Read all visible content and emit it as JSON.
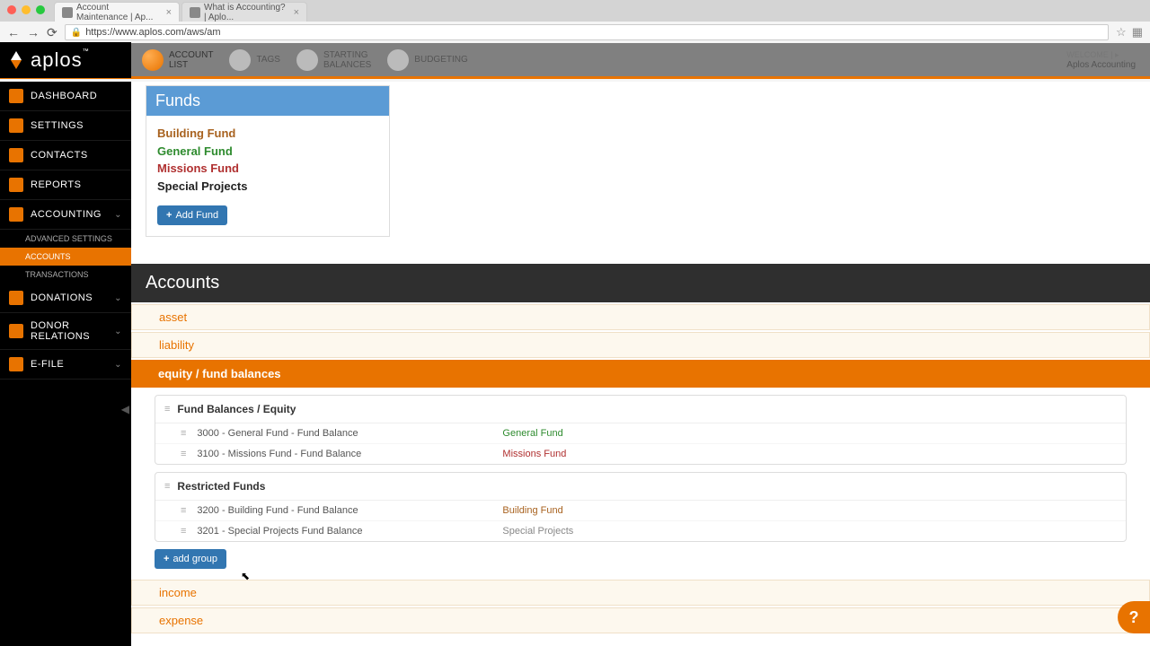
{
  "browser": {
    "tabs": [
      {
        "title": "Account Maintenance | Ap...",
        "active": true
      },
      {
        "title": "What is Accounting? | Aplo...",
        "active": false
      }
    ],
    "url": "https://www.aplos.com/aws/am"
  },
  "header": {
    "logo": "aplos",
    "nav": [
      {
        "label_l1": "ACCOUNT",
        "label_l2": "LIST",
        "active": true
      },
      {
        "label_l1": "TAGS",
        "label_l2": "",
        "active": false
      },
      {
        "label_l1": "STARTING",
        "label_l2": "BALANCES",
        "active": false
      },
      {
        "label_l1": "BUDGETING",
        "label_l2": "",
        "active": false
      }
    ],
    "welcome_label": "WELCOME | ▸",
    "org_name": "Aplos Accounting"
  },
  "sidebar": {
    "items": [
      {
        "label": "DASHBOARD",
        "expandable": false
      },
      {
        "label": "SETTINGS",
        "expandable": false
      },
      {
        "label": "CONTACTS",
        "expandable": false
      },
      {
        "label": "REPORTS",
        "expandable": false
      },
      {
        "label": "ACCOUNTING",
        "expandable": true,
        "expanded": true,
        "children": [
          {
            "label": "ADVANCED SETTINGS",
            "active": false
          },
          {
            "label": "ACCOUNTS",
            "active": true
          },
          {
            "label": "TRANSACTIONS",
            "active": false
          }
        ]
      },
      {
        "label": "DONATIONS",
        "expandable": true
      },
      {
        "label": "DONOR RELATIONS",
        "expandable": true
      },
      {
        "label": "E-FILE",
        "expandable": true
      }
    ]
  },
  "funds": {
    "title": "Funds",
    "items": [
      {
        "name": "Building Fund",
        "color": "brown"
      },
      {
        "name": "General Fund",
        "color": "green"
      },
      {
        "name": "Missions Fund",
        "color": "red"
      },
      {
        "name": "Special Projects",
        "color": "black"
      }
    ],
    "add_label": "Add Fund"
  },
  "accounts": {
    "title": "Accounts",
    "categories": [
      {
        "label": "asset",
        "active": false
      },
      {
        "label": "liability",
        "active": false
      },
      {
        "label": "equity / fund balances",
        "active": true
      },
      {
        "label": "income",
        "active": false
      },
      {
        "label": "expense",
        "active": false
      }
    ],
    "groups": [
      {
        "name": "Fund Balances / Equity",
        "rows": [
          {
            "name": "3000 - General Fund - Fund Balance",
            "fund": "General Fund",
            "fund_color": "green"
          },
          {
            "name": "3100 - Missions Fund - Fund Balance",
            "fund": "Missions Fund",
            "fund_color": "red"
          }
        ]
      },
      {
        "name": "Restricted Funds",
        "rows": [
          {
            "name": "3200 - Building Fund - Fund Balance",
            "fund": "Building Fund",
            "fund_color": "brown"
          },
          {
            "name": "3201 - Special Projects Fund Balance",
            "fund": "Special Projects",
            "fund_color": ""
          }
        ]
      }
    ],
    "add_group_label": "add group"
  },
  "help_label": "?"
}
